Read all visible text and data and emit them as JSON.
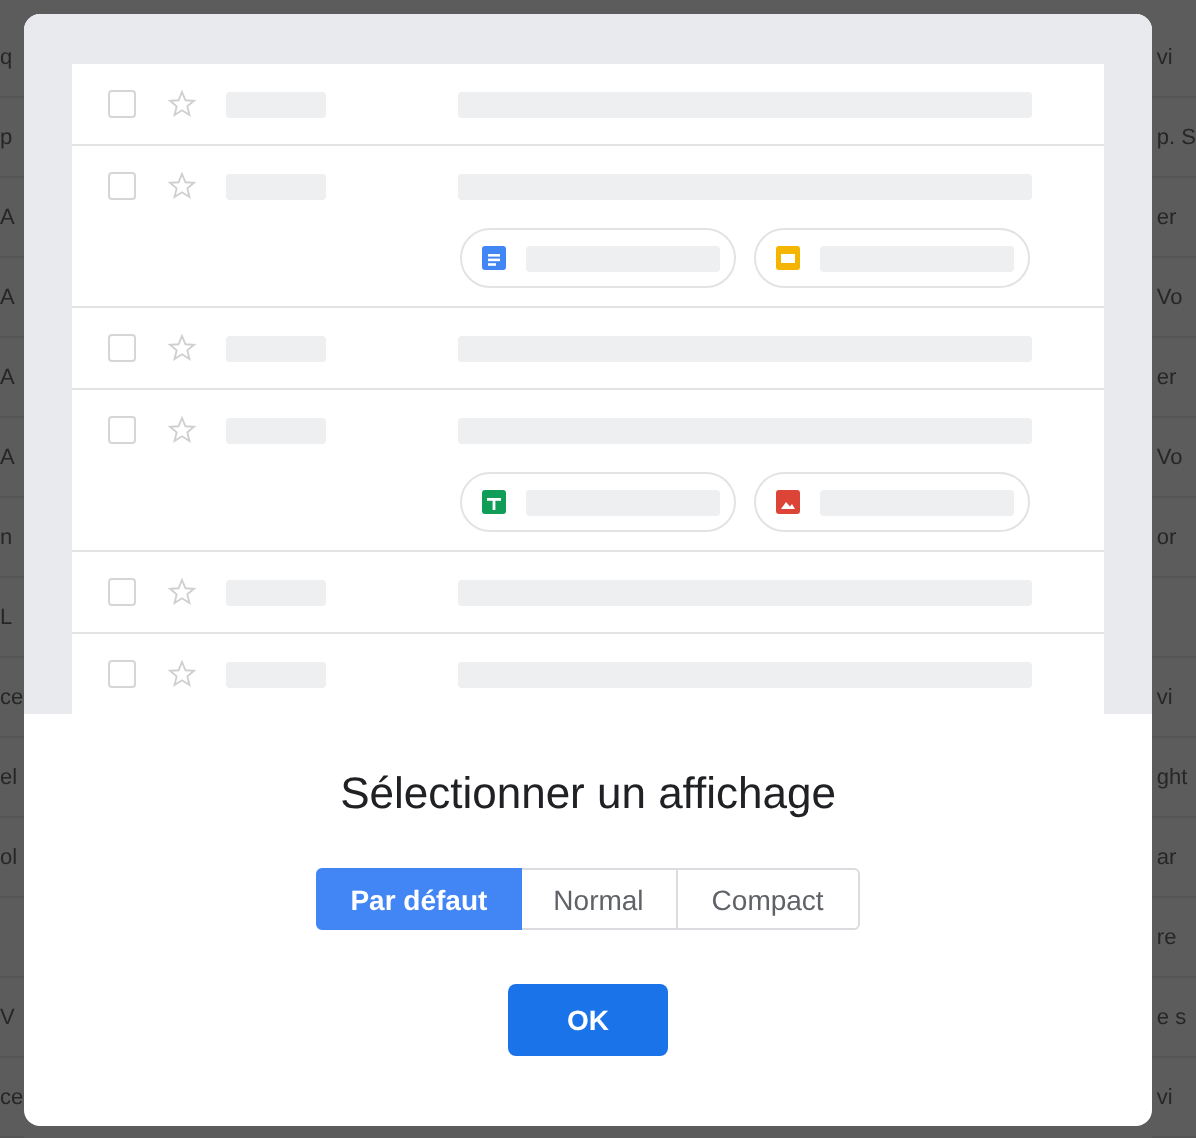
{
  "background_rows": [
    {
      "left": "q",
      "right": "vi"
    },
    {
      "left": "p",
      "right": "p. S"
    },
    {
      "left": "A",
      "right": "er"
    },
    {
      "left": "A",
      "right": "Vo"
    },
    {
      "left": "A",
      "right": "er"
    },
    {
      "left": "A",
      "right": "Vo"
    },
    {
      "left": "n",
      "right": "or"
    },
    {
      "left": "L"
    },
    {
      "left": "ce",
      "right": "vi"
    },
    {
      "left": "el",
      "right": "ght"
    },
    {
      "left": "ol",
      "right": "ar"
    },
    {
      "right": "re"
    },
    {
      "left": "V",
      "right": "e s"
    },
    {
      "left": "ce",
      "right": "vi"
    }
  ],
  "preview_rows": [
    {
      "kind": "plain",
      "checked": false
    },
    {
      "kind": "with_attachments",
      "checked": false,
      "attachments": [
        {
          "kind": "doc"
        },
        {
          "kind": "slides"
        }
      ]
    },
    {
      "kind": "plain",
      "checked": false
    },
    {
      "kind": "with_attachments",
      "checked": false,
      "attachments": [
        {
          "kind": "sheet"
        },
        {
          "kind": "image"
        }
      ]
    },
    {
      "kind": "plain",
      "checked": false
    },
    {
      "kind": "plain",
      "checked": false
    }
  ],
  "dialog": {
    "title": "Sélectionner un affichage",
    "options": [
      {
        "label": "Par défaut",
        "selected": true
      },
      {
        "label": "Normal",
        "selected": false
      },
      {
        "label": "Compact",
        "selected": false
      }
    ],
    "button": "OK"
  }
}
